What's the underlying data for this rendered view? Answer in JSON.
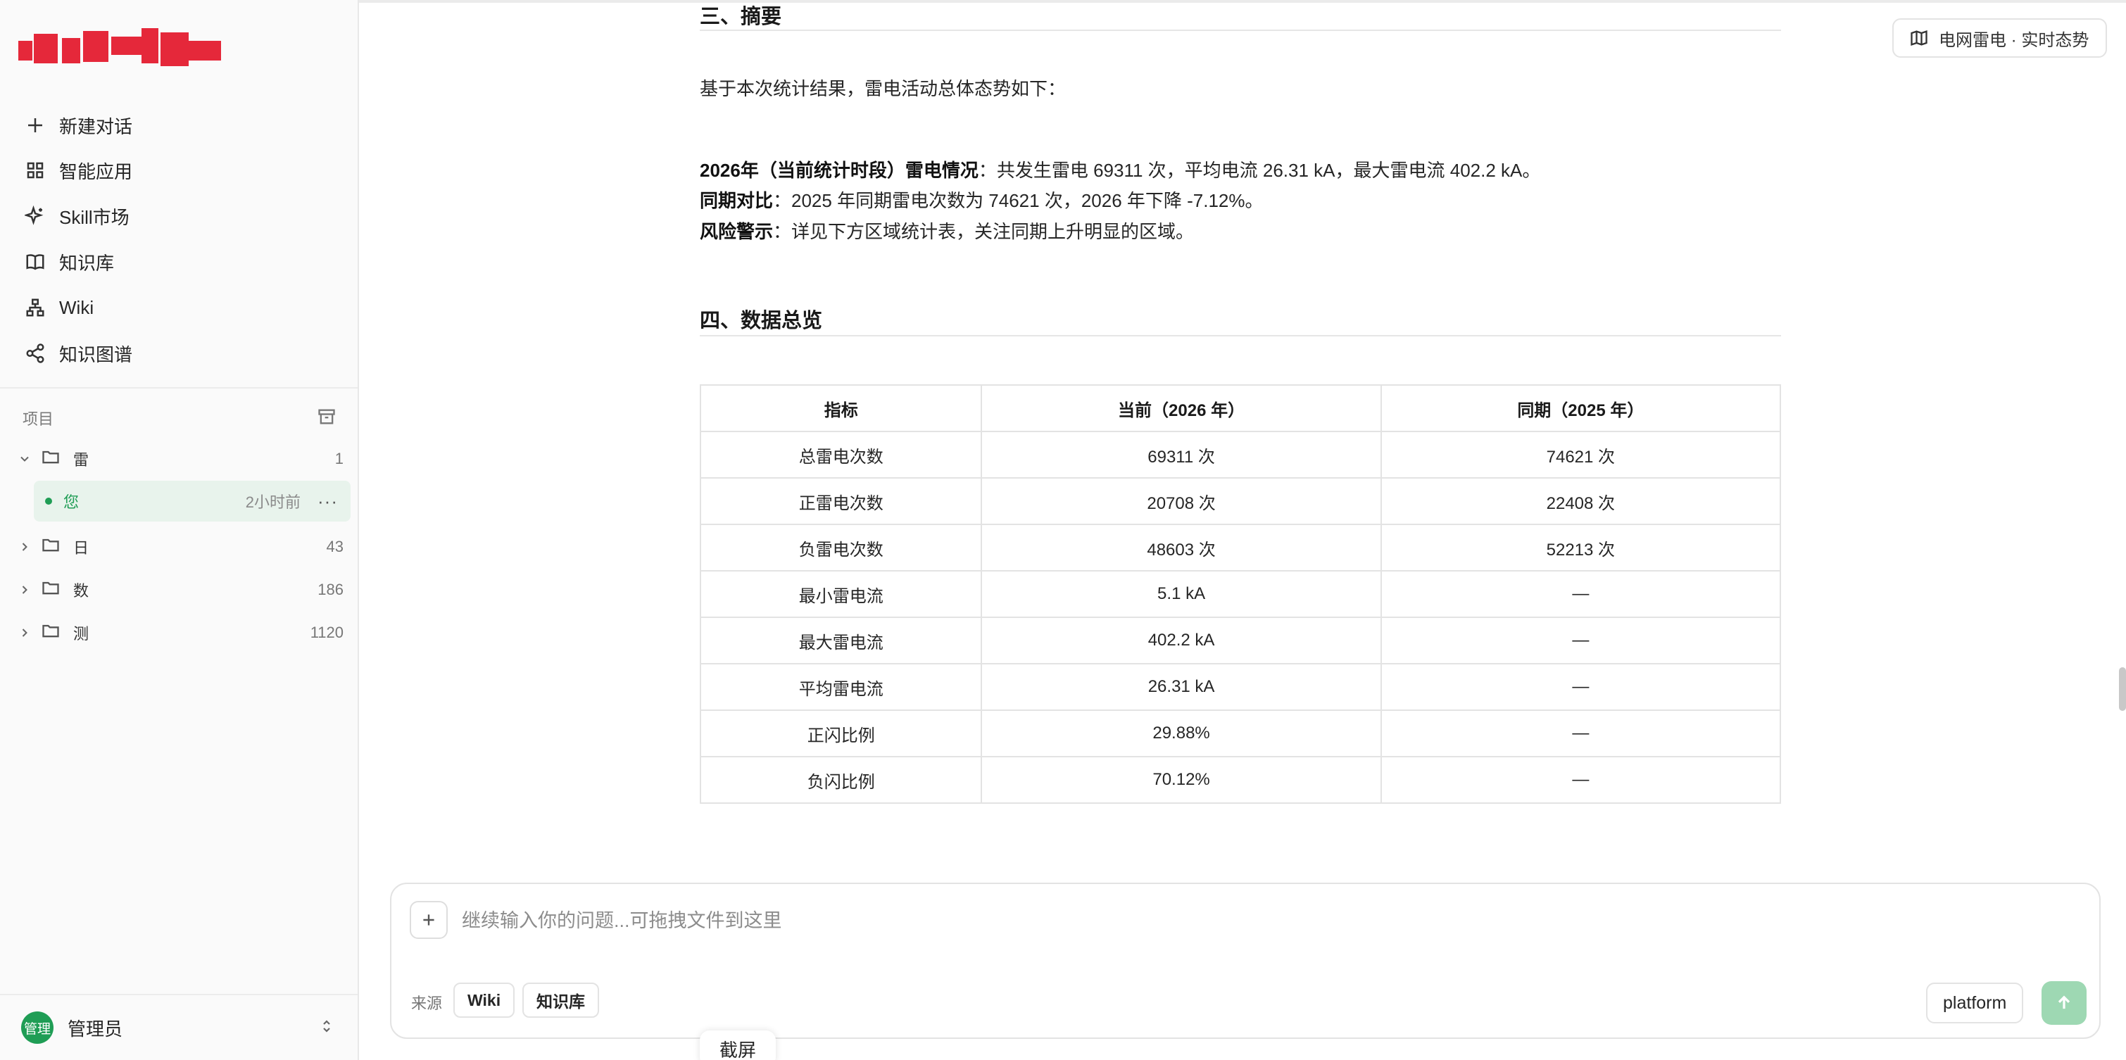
{
  "sidebar": {
    "nav": [
      {
        "label": "新建对话",
        "icon": "plus-icon"
      },
      {
        "label": "智能应用",
        "icon": "grid-icon"
      },
      {
        "label": "Skill市场",
        "icon": "sparkle-icon"
      },
      {
        "label": "知识库",
        "icon": "book-icon"
      },
      {
        "label": "Wiki",
        "icon": "workflow-icon"
      },
      {
        "label": "知识图谱",
        "icon": "share-graph-icon"
      }
    ],
    "section_label": "项目",
    "projects": [
      {
        "name": "雷",
        "count": "1",
        "expanded": true
      },
      {
        "name": "日",
        "count": "43",
        "expanded": false
      },
      {
        "name": "数",
        "count": "186",
        "expanded": false
      },
      {
        "name": "测",
        "count": "1120",
        "expanded": false
      }
    ],
    "active_session": {
      "name": "您",
      "time": "2小时前",
      "more": "···"
    },
    "user": {
      "avatar": "管理",
      "name": "管理员"
    }
  },
  "top_tag": {
    "label": "电网雷电 · 实时态势",
    "icon": "map-icon"
  },
  "report": {
    "section3_title": "三、摘要",
    "intro": "基于本次统计结果，雷电活动总体态势如下：",
    "line1_bold": "2026年（当前统计时段）雷电情况",
    "line1_text": "：共发生雷电 69311 次，平均电流 26.31 kA，最大雷电流 402.2 kA。",
    "line2_bold": "同期对比",
    "line2_text": "：2025 年同期雷电次数为 74621 次，2026 年下降 -7.12%。",
    "line3_bold": "风险警示",
    "line3_text": "：详见下方区域统计表，关注同期上升明显的区域。",
    "section4_title": "四、数据总览",
    "table": {
      "headers": [
        "指标",
        "当前（2026 年）",
        "同期（2025 年）"
      ],
      "rows": [
        [
          "总雷电次数",
          "69311 次",
          "74621 次"
        ],
        [
          "正雷电次数",
          "20708 次",
          "22408 次"
        ],
        [
          "负雷电次数",
          "48603 次",
          "52213 次"
        ],
        [
          "最小雷电流",
          "5.1 kA",
          "—"
        ],
        [
          "最大雷电流",
          "402.2 kA",
          "—"
        ],
        [
          "平均雷电流",
          "26.31 kA",
          "—"
        ],
        [
          "正闪比例",
          "29.88%",
          "—"
        ],
        [
          "负闪比例",
          "70.12%",
          "—"
        ]
      ]
    }
  },
  "composer": {
    "placeholder": "继续输入你的问题...可拖拽文件到这里",
    "source_label": "来源",
    "chips": [
      "Wiki",
      "知识库"
    ],
    "platform_label": "platform"
  },
  "screenshot_label": "截屏"
}
